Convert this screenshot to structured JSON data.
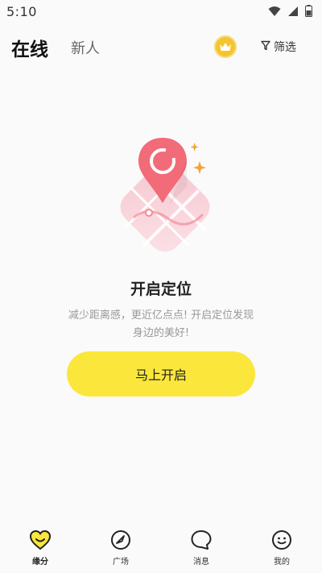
{
  "status_bar": {
    "time": "5:10"
  },
  "header": {
    "tab_online": "在线",
    "tab_new": "新人",
    "filter_label": "筛选"
  },
  "empty_state": {
    "title": "开启定位",
    "description": "减少距离感，更近亿点点! 开启定位发现身边的美好!",
    "button_label": "马上开启"
  },
  "bottom_nav": {
    "items": [
      {
        "label": "缘分",
        "icon": "heart-icon",
        "active": true
      },
      {
        "label": "广场",
        "icon": "compass-icon",
        "active": false
      },
      {
        "label": "消息",
        "icon": "chat-bubble-icon",
        "active": false
      },
      {
        "label": "我的",
        "icon": "smiley-icon",
        "active": false
      }
    ]
  },
  "colors": {
    "accent_yellow": "#fbe73b",
    "vip_gold": "#f4c431",
    "pin_red": "#f26b78",
    "sparkle_orange": "#f5a23a"
  }
}
